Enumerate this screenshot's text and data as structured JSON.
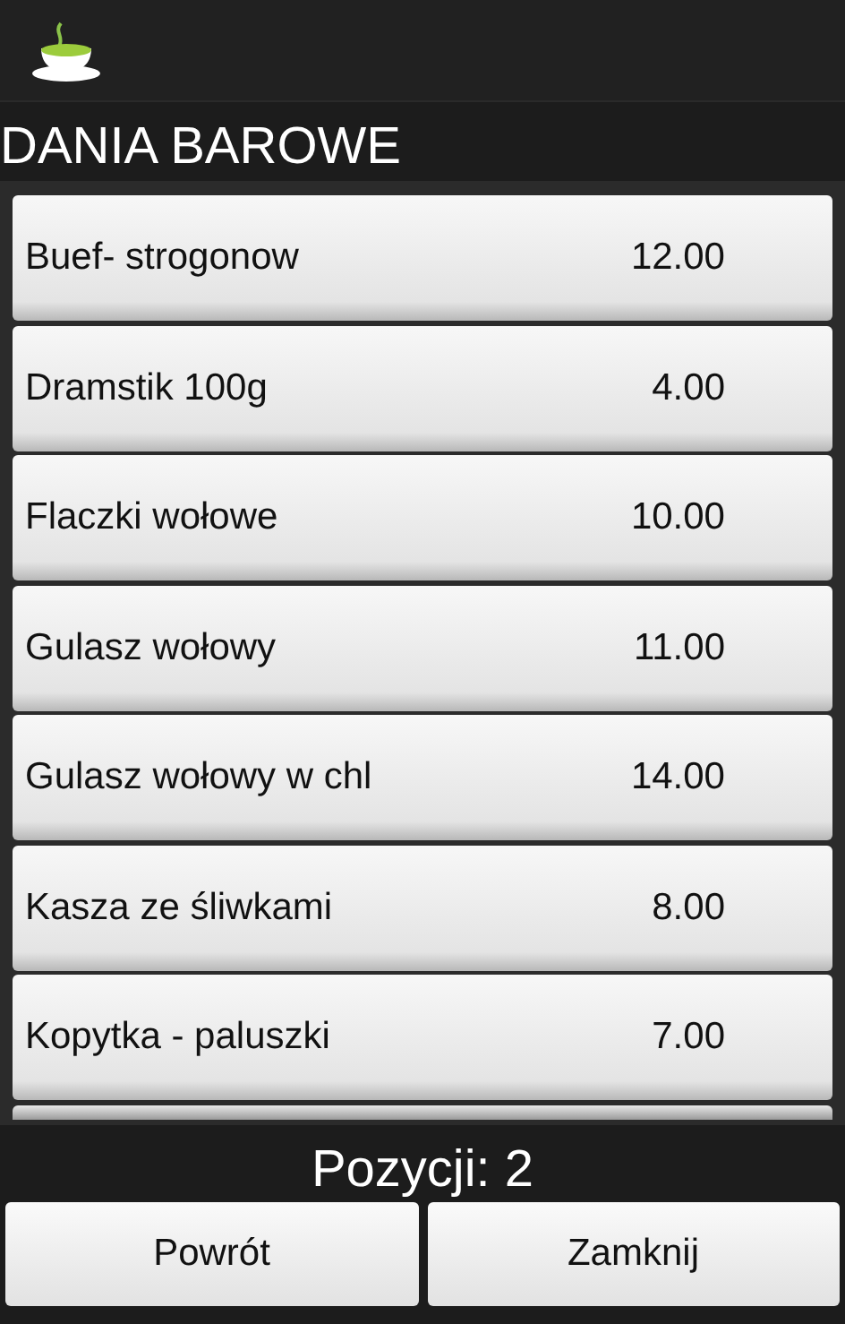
{
  "title": "DANIA BAROWE",
  "items": [
    {
      "name": "Buef- strogonow",
      "price": "12.00"
    },
    {
      "name": "Dramstik 100g",
      "price": "4.00"
    },
    {
      "name": "Flaczki wołowe",
      "price": "10.00"
    },
    {
      "name": "Gulasz wołowy",
      "price": "11.00"
    },
    {
      "name": "Gulasz wołowy w chl",
      "price": "14.00"
    },
    {
      "name": "Kasza ze śliwkami",
      "price": "8.00"
    },
    {
      "name": "Kopytka - paluszki",
      "price": "7.00"
    }
  ],
  "counter": "Pozycji: 2",
  "buttons": [
    "Powrót",
    "Zamknij"
  ]
}
